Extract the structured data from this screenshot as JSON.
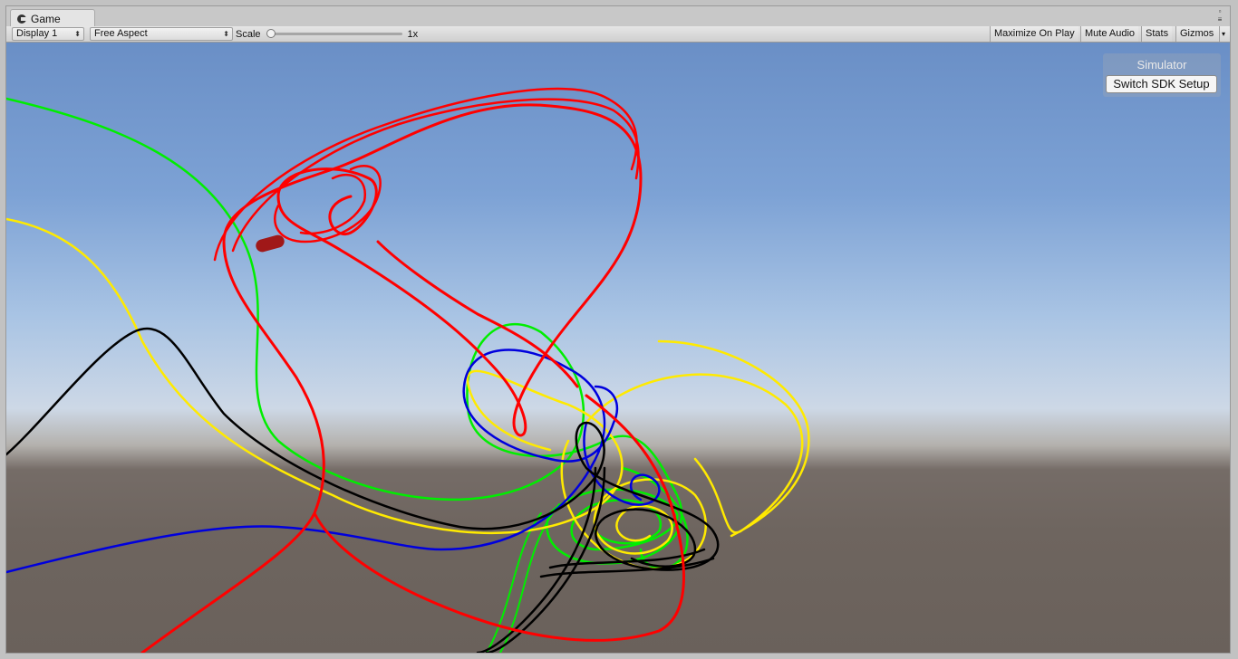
{
  "tab": {
    "title": "Game"
  },
  "toolbar": {
    "display": "Display 1",
    "aspect": "Free Aspect",
    "scale_label": "Scale",
    "scale_value": "1x",
    "buttons": {
      "maximize": "Maximize On Play",
      "mute": "Mute Audio",
      "stats": "Stats",
      "gizmos": "Gizmos"
    }
  },
  "simulator": {
    "title": "Simulator",
    "button": "Switch SDK Setup"
  },
  "colors": {
    "red_trail": "#ff0000",
    "green_trail": "#00ee00",
    "yellow_trail": "#ffea00",
    "blue_trail": "#0000dd",
    "black_trail": "#000000"
  }
}
